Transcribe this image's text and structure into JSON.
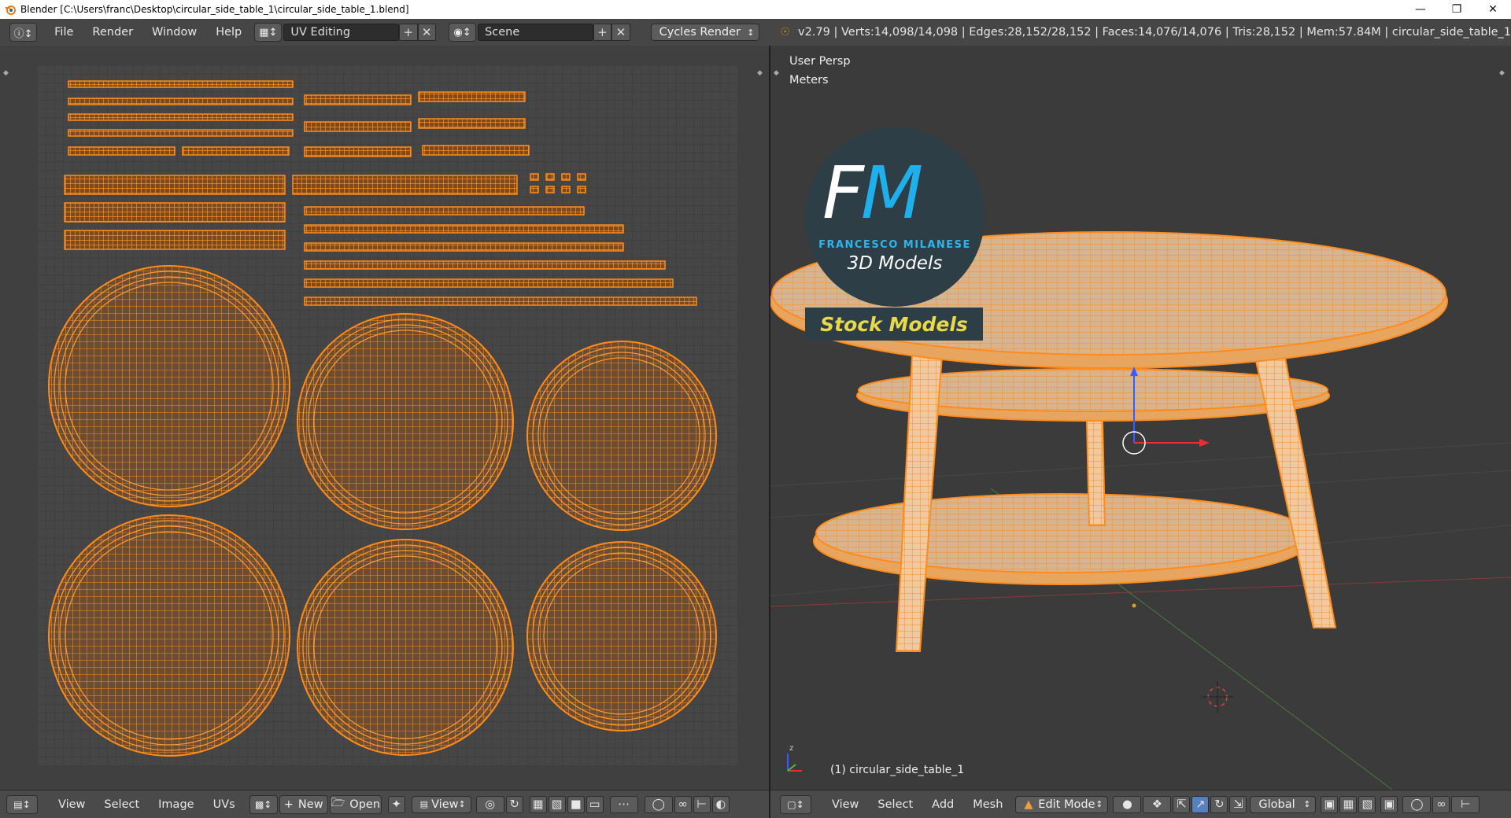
{
  "titlebar": {
    "title": "Blender [C:\\Users\\franc\\Desktop\\circular_side_table_1\\circular_side_table_1.blend]"
  },
  "info": {
    "menus": [
      "File",
      "Render",
      "Window",
      "Help"
    ],
    "screen_layout": "UV Editing",
    "scene": "Scene",
    "render_engine": "Cycles Render",
    "stats": "v2.79 | Verts:14,098/14,098 | Edges:28,152/28,152 | Faces:14,076/14,076 | Tris:28,152 | Mem:57.84M | circular_side_table_1"
  },
  "uv_editor": {
    "menus": [
      "View",
      "Select",
      "Image",
      "UVs"
    ],
    "new_label": "New",
    "open_label": "Open",
    "view_label": "View"
  },
  "viewport": {
    "perspective": "User Persp",
    "units": "Meters",
    "object_label": "(1) circular_side_table_1",
    "menus": [
      "View",
      "Select",
      "Add",
      "Mesh"
    ],
    "mode": "Edit Mode",
    "orientation": "Global"
  },
  "logo": {
    "letters": "FM",
    "name": "FRANCESCO MILANESE",
    "tagline": "3D Models",
    "banner": "Stock Models"
  },
  "colors": {
    "wire": "#ff8c1a",
    "logo_circle": "#2e3e46",
    "logo_blue": "#1fb0ec",
    "banner_text": "#e8d84a"
  }
}
